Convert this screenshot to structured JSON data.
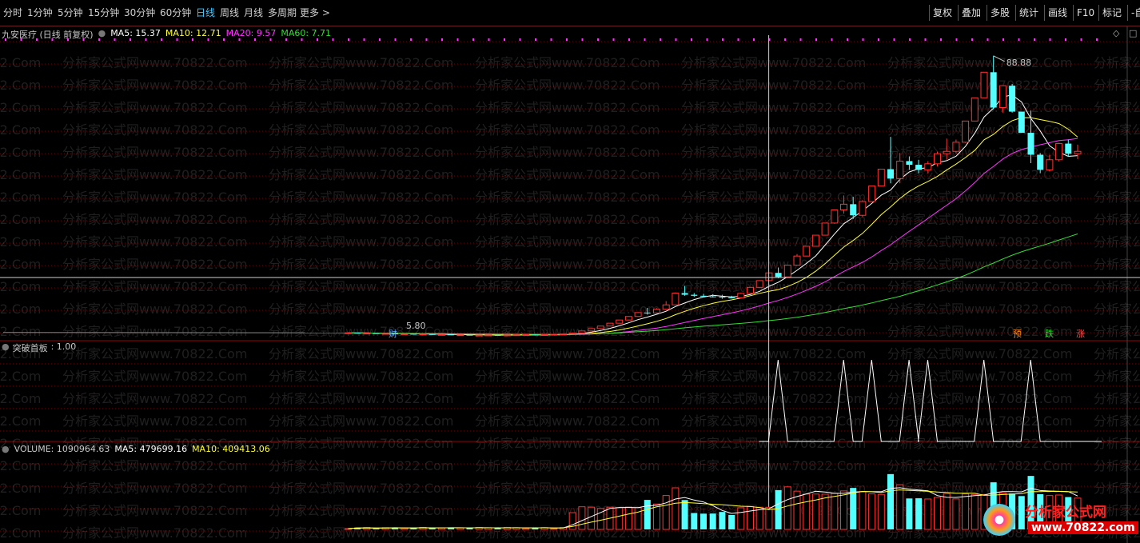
{
  "toolbar": {
    "periods": [
      "分时",
      "1分钟",
      "5分钟",
      "15分钟",
      "30分钟",
      "60分钟",
      "日线",
      "周线",
      "月线",
      "多周期",
      "更多 >"
    ],
    "active_period": "日线",
    "right_buttons": [
      "复权",
      "叠加",
      "多股",
      "统计",
      "画线",
      "F10",
      "标记",
      "-自"
    ]
  },
  "watermark": "分析家公式网www.70822.Com",
  "logo": {
    "text": "分析家公式网",
    "url": "www.70822.com"
  },
  "colors": {
    "ma5": "#ffffff",
    "ma10": "#ffff33",
    "ma20": "#ff33ff",
    "ma60": "#33dd33",
    "up": "#ff3232",
    "down": "#54ffff",
    "grid": "#7a0000"
  },
  "chart_data": [
    {
      "type": "candlestick",
      "title": "九安医疗 (日线 前复权)",
      "indicators": [
        {
          "name": "MA5",
          "label": "MA5: 15.37",
          "color": "#ffffff"
        },
        {
          "name": "MA10",
          "label": "MA10: 12.71",
          "color": "#ffff33"
        },
        {
          "name": "MA20",
          "label": "MA20: 9.57",
          "color": "#ff33ff"
        },
        {
          "name": "MA60",
          "label": "MA60: 7.71",
          "color": "#33dd33"
        }
      ],
      "annotations": {
        "high": "88.88",
        "low": "5.80",
        "markers": [
          "财",
          "预",
          "跌",
          "涨"
        ]
      },
      "candles": [
        [
          6.6,
          6.7,
          6.5,
          6.6
        ],
        [
          6.6,
          6.6,
          6.4,
          6.5
        ],
        [
          6.5,
          6.6,
          6.4,
          6.5
        ],
        [
          6.5,
          6.5,
          6.3,
          6.4
        ],
        [
          6.4,
          6.5,
          6.3,
          6.4
        ],
        [
          6.4,
          6.4,
          6.2,
          6.3
        ],
        [
          6.3,
          6.4,
          6.2,
          6.3
        ],
        [
          6.3,
          6.3,
          6.1,
          6.2
        ],
        [
          6.2,
          6.3,
          6.1,
          6.2
        ],
        [
          6.2,
          6.2,
          6.0,
          6.1
        ],
        [
          6.1,
          6.2,
          6.0,
          6.1
        ],
        [
          6.1,
          6.1,
          5.9,
          6.0
        ],
        [
          6.0,
          6.1,
          5.9,
          6.0
        ],
        [
          6.0,
          6.0,
          5.8,
          5.9
        ],
        [
          5.9,
          6.0,
          5.8,
          5.9
        ],
        [
          5.9,
          6.0,
          5.8,
          5.95
        ],
        [
          5.95,
          6.0,
          5.85,
          5.9
        ],
        [
          5.9,
          6.0,
          5.85,
          5.95
        ],
        [
          5.95,
          6.05,
          5.9,
          6.0
        ],
        [
          6.0,
          6.1,
          5.95,
          6.05
        ],
        [
          6.05,
          6.1,
          5.95,
          6.0
        ],
        [
          6.0,
          6.1,
          5.9,
          6.05
        ],
        [
          6.05,
          6.2,
          6.0,
          6.15
        ],
        [
          6.15,
          6.3,
          6.1,
          6.25
        ],
        [
          6.25,
          6.6,
          6.2,
          6.5
        ],
        [
          6.5,
          7.2,
          6.5,
          7.15
        ],
        [
          7.15,
          7.9,
          7.15,
          7.85
        ],
        [
          7.85,
          8.6,
          7.85,
          8.6
        ],
        [
          8.6,
          9.5,
          8.6,
          9.45
        ],
        [
          9.45,
          10.4,
          9.45,
          10.4
        ],
        [
          10.4,
          11.5,
          10.4,
          11.45
        ],
        [
          11.45,
          12.6,
          11.45,
          12.6
        ],
        [
          12.6,
          14.0,
          12.0,
          12.5
        ],
        [
          12.5,
          13.9,
          12.3,
          13.6
        ],
        [
          13.6,
          16.0,
          13.4,
          14.9
        ],
        [
          14.9,
          18.6,
          14.9,
          18.4
        ],
        [
          18.4,
          20.5,
          17.6,
          17.9
        ],
        [
          17.9,
          18.4,
          17.3,
          17.6
        ],
        [
          17.6,
          18.2,
          17.2,
          17.4
        ],
        [
          17.4,
          18.1,
          17.1,
          17.3
        ],
        [
          17.3,
          17.9,
          16.7,
          17.1
        ],
        [
          17.1,
          17.6,
          16.8,
          17.0
        ],
        [
          17.0,
          18.5,
          16.8,
          18.3
        ],
        [
          18.3,
          20.2,
          18.2,
          20.1
        ],
        [
          20.1,
          22.1,
          20.0,
          22.1
        ],
        [
          22.1,
          24.4,
          22.1,
          24.4
        ],
        [
          24.4,
          26.0,
          22.8,
          23.2
        ],
        [
          23.2,
          26.8,
          23.2,
          26.7
        ],
        [
          26.7,
          30.0,
          26.7,
          29.4
        ],
        [
          29.4,
          32.4,
          29.4,
          32.3
        ],
        [
          32.3,
          35.6,
          32.3,
          35.6
        ],
        [
          35.6,
          39.2,
          35.6,
          39.2
        ],
        [
          39.2,
          43.2,
          39.0,
          43.1
        ],
        [
          43.1,
          47.4,
          42.0,
          44.8
        ],
        [
          44.8,
          47.0,
          40.4,
          41.5
        ],
        [
          41.5,
          46.0,
          41.0,
          45.6
        ],
        [
          45.6,
          50.2,
          45.5,
          50.2
        ],
        [
          50.2,
          55.2,
          50.2,
          55.2
        ],
        [
          55.2,
          64.8,
          51.0,
          52.4
        ],
        [
          52.4,
          60.0,
          51.0,
          57.6
        ],
        [
          57.6,
          59.0,
          55.0,
          56.5
        ],
        [
          56.5,
          58.0,
          54.0,
          55.0
        ],
        [
          55.0,
          57.6,
          54.0,
          56.8
        ],
        [
          56.8,
          60.4,
          56.0,
          59.8
        ],
        [
          59.8,
          64.3,
          58.0,
          60.5
        ],
        [
          60.5,
          64.0,
          60.0,
          63.2
        ],
        [
          63.2,
          69.5,
          63.0,
          69.5
        ],
        [
          69.5,
          76.4,
          69.5,
          76.4
        ],
        [
          76.4,
          84.0,
          76.4,
          84.0
        ],
        [
          84.0,
          88.88,
          73.0,
          73.5
        ],
        [
          73.5,
          80.0,
          72.0,
          80.0
        ],
        [
          80.0,
          80.5,
          72.0,
          72.3
        ],
        [
          72.3,
          72.3,
          66.0,
          66.0
        ],
        [
          66.0,
          72.6,
          57.0,
          59.5
        ],
        [
          59.5,
          60.0,
          54.0,
          55.0
        ],
        [
          55.0,
          59.5,
          54.5,
          58.0
        ],
        [
          58.0,
          63.0,
          57.5,
          62.8
        ],
        [
          62.8,
          64.0,
          59.0,
          59.8
        ],
        [
          59.8,
          62.5,
          58.2,
          60.5
        ]
      ],
      "ylim": [
        4.5,
        95
      ]
    },
    {
      "type": "line",
      "title": "突破首板",
      "value_label": ": 1.00",
      "ylim": [
        0,
        1
      ],
      "spike_x": [
        47,
        54,
        57,
        61,
        63,
        69,
        74
      ]
    },
    {
      "type": "bar",
      "title": "VOLUME",
      "indicators": [
        {
          "name": "VOLUME",
          "label": "VOLUME: 1090964.63",
          "color": "#c8c8c8"
        },
        {
          "name": "MA5",
          "label": "MA5: 479699.16",
          "color": "#ffffff"
        },
        {
          "name": "MA10",
          "label": "MA10: 409413.06",
          "color": "#ffff33"
        }
      ],
      "ylim": [
        0,
        1150000
      ]
    }
  ]
}
